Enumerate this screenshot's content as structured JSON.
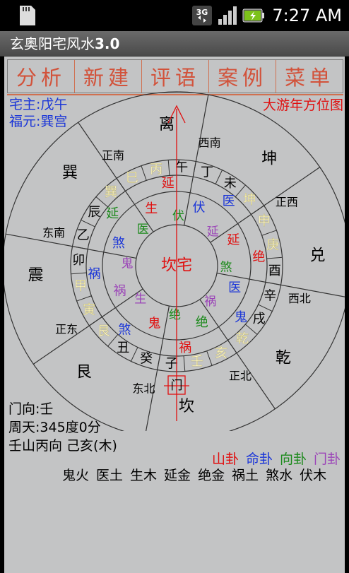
{
  "status_bar": {
    "time": "7:27 AM",
    "icons": [
      "sd-card-icon",
      "3g-icon",
      "signal-icon",
      "battery-icon"
    ]
  },
  "app": {
    "title_prefix": "玄奥阳宅风水",
    "title_version": "3.0"
  },
  "menu": [
    "分析",
    "新建",
    "评语",
    "案例",
    "菜单"
  ],
  "owner": {
    "zhai_zhu": "宅主:戊午",
    "fu_yuan": "福元:巽宫"
  },
  "chart_title": "大游年方位图",
  "center_label": "坎宅",
  "trigrams": [
    "离",
    "坤",
    "兑",
    "乾",
    "坎",
    "艮",
    "震",
    "巽"
  ],
  "directions": [
    "正南",
    "西南",
    "正西",
    "西北",
    "正北",
    "东北",
    "正东",
    "东南"
  ],
  "mountains": [
    "丙",
    "午",
    "丁",
    "未",
    "坤",
    "申",
    "庚",
    "酉",
    "辛",
    "戌",
    "乾",
    "亥",
    "壬",
    "子",
    "癸",
    "丑",
    "艮",
    "寅",
    "甲",
    "卯",
    "乙",
    "辰",
    "巽",
    "巳"
  ],
  "ring_mountain_mark": [
    "伏",
    "延",
    "绝",
    "鬼",
    "祸",
    "煞",
    "伏",
    "祸",
    "生",
    "鬼",
    "绝",
    "医",
    "生",
    "伏"
  ],
  "inner_stars": [
    {
      "t": "延",
      "c": "red"
    },
    {
      "t": "医",
      "c": "blue"
    },
    {
      "t": "绝",
      "c": "red"
    },
    {
      "t": "鬼",
      "c": "blue"
    },
    {
      "t": "祸",
      "c": "red"
    },
    {
      "t": "煞",
      "c": "blue"
    },
    {
      "t": "祸",
      "c": "blue"
    },
    {
      "t": "延",
      "c": "green"
    }
  ],
  "door_label": "门",
  "door_facing": "门向:壬",
  "zhou_tian": "周天:345度0分",
  "shan_xiang": "壬山丙向 己亥(木)",
  "legend": [
    {
      "label": "山卦",
      "color": "#e01010"
    },
    {
      "label": "命卦",
      "color": "#1a35d8"
    },
    {
      "label": "向卦",
      "color": "#1c8a1c"
    },
    {
      "label": "门卦",
      "color": "#9b44b8"
    }
  ],
  "gua_results": [
    "鬼火",
    "医土",
    "生木",
    "延金",
    "绝金",
    "祸土",
    "煞水",
    "伏木"
  ],
  "colors": {
    "red": "#e01010",
    "blue": "#1a35d8",
    "green": "#1c8a1c",
    "purple": "#9b44b8",
    "cream": "#f4f0b0",
    "brown": "#b08040"
  }
}
